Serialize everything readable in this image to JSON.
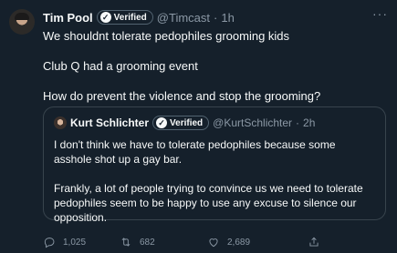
{
  "tweet": {
    "author_name": "Tim Pool",
    "verified_label": "Verified",
    "handle": "@Timcast",
    "separator": "·",
    "time": "1h",
    "lines": [
      "We shouldnt tolerate pedophiles grooming kids",
      "Club Q had a grooming event",
      "How do prevent the violence and stop the grooming?"
    ],
    "more_icon": "more-icon"
  },
  "quoted": {
    "author_name": "Kurt Schlichter",
    "verified_label": "Verified",
    "handle": "@KurtSchlichter",
    "separator": "·",
    "time": "2h",
    "paragraphs": [
      "I don't think we have to tolerate pedophiles because some asshole shot up a gay bar.",
      "Frankly, a lot of people trying to convince us we need to tolerate pedophiles seem to be happy to use any excuse to silence our opposition."
    ]
  },
  "actions": {
    "replies": "1,025",
    "retweets": "682",
    "likes": "2,689",
    "icons": [
      "reply-icon",
      "retweet-icon",
      "like-icon",
      "share-icon"
    ]
  },
  "colors": {
    "background": "#15202b",
    "text": "#f7f9f9",
    "muted": "#8b98a5",
    "border": "#38444d"
  }
}
